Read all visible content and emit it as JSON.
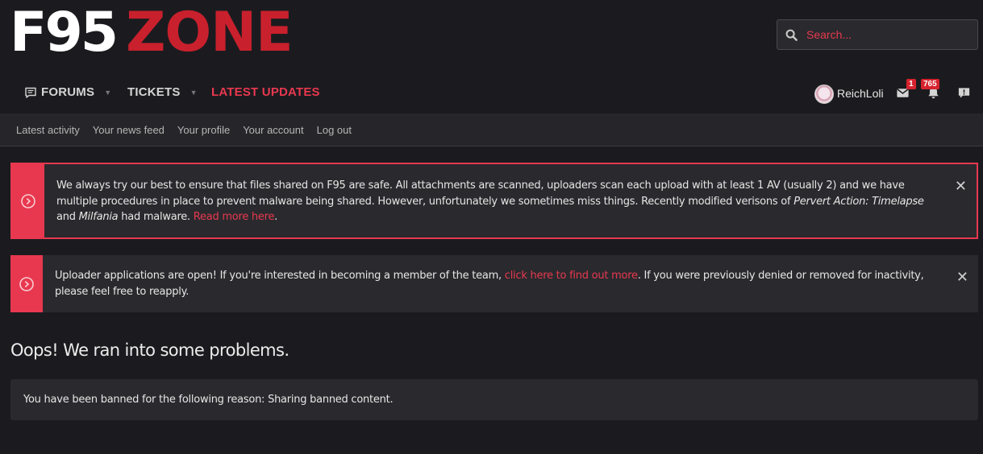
{
  "logo": {
    "part1": "F95",
    "part2": "ZONE"
  },
  "search": {
    "placeholder": "Search..."
  },
  "nav": {
    "forums": "FORUMS",
    "tickets": "TICKETS",
    "latest": "LATEST UPDATES"
  },
  "user": {
    "name": "ReichLoli",
    "inbox_count": "1",
    "alerts_count": "765"
  },
  "subnav": [
    "Latest activity",
    "Your news feed",
    "Your profile",
    "Your account",
    "Log out"
  ],
  "notice1": {
    "text_a": "We always try our best to ensure that files shared on F95 are safe. All attachments are scanned, uploaders scan each upload with at least 1 AV (usually 2) and we have multiple procedures in place to prevent malware being shared. However, unfortunately we sometimes miss things. Recently modified verisons of ",
    "game1": "Pervert Action: Timelapse",
    "text_b": " and ",
    "game2": "Milfania",
    "text_c": " had malware. ",
    "link": "Read more here",
    "text_d": "."
  },
  "notice2": {
    "text_a": "Uploader applications are open! If you're interested in becoming a member of the team, ",
    "link": "click here to find out more",
    "text_b": ". If you were previously denied or removed for inactivity, please feel free to reapply."
  },
  "error": {
    "title": "Oops! We ran into some problems.",
    "message": "You have been banned for the following reason: Sharing banned content."
  },
  "colors": {
    "accent": "#e8384f",
    "background": "#1b1b1f",
    "panel": "#2a2a2e"
  }
}
